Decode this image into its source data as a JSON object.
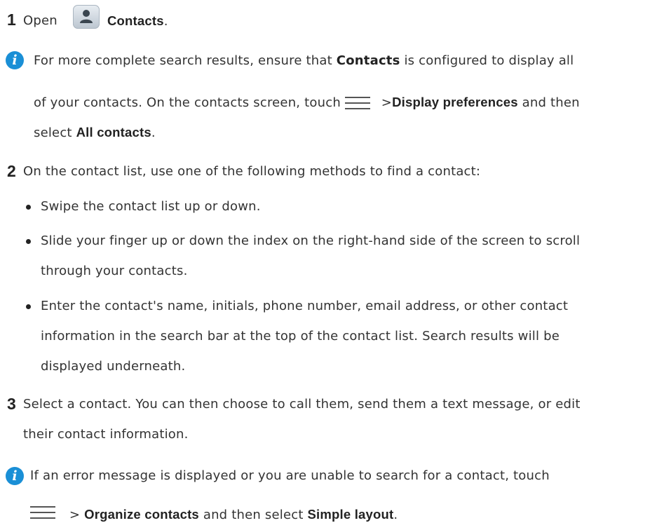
{
  "step1": {
    "number": "1",
    "text_open": "Open",
    "app_name": "Contacts",
    "period": "."
  },
  "note1": {
    "line1_pre": "For more complete search results, ensure that",
    "line1_bold": "Contacts",
    "line1_post": "is configured to display all",
    "line2_pre": "of your contacts. On the contacts screen, touch",
    "line2_gt": ">",
    "line2_bold": "Display preferences",
    "line2_post": "and then",
    "line3_pre": "select",
    "line3_bold": "All contacts",
    "line3_post": "."
  },
  "step2": {
    "number": "2",
    "text": "On the contact list, use one of the following methods to find a contact:",
    "bullets": [
      {
        "lines": [
          "Swipe the contact list up or down."
        ]
      },
      {
        "lines": [
          "Slide your finger up or down the index on the right-hand side of the screen to scroll",
          "through your contacts."
        ]
      },
      {
        "lines": [
          "Enter the contact's name, initials, phone number, email address, or other contact",
          "information in the search bar at the top of the contact list. Search results will be",
          "displayed underneath."
        ]
      }
    ]
  },
  "step3": {
    "number": "3",
    "line1": "Select a contact. You can then choose to call them, send them a text message, or edit",
    "line2": "their contact information."
  },
  "note2": {
    "line1": "If an error message is displayed or you are unable to search for a contact, touch",
    "line2_gt": ">",
    "line2_bold1": "Organize contacts",
    "line2_mid": "and then select",
    "line2_bold2": "Simple layout",
    "line2_post": "."
  },
  "icons": {
    "contacts_app": "contacts-app-icon",
    "info": "info-icon",
    "menu": "menu-icon"
  },
  "colors": {
    "info_blue": "#1a8fd6",
    "text": "#333333"
  }
}
